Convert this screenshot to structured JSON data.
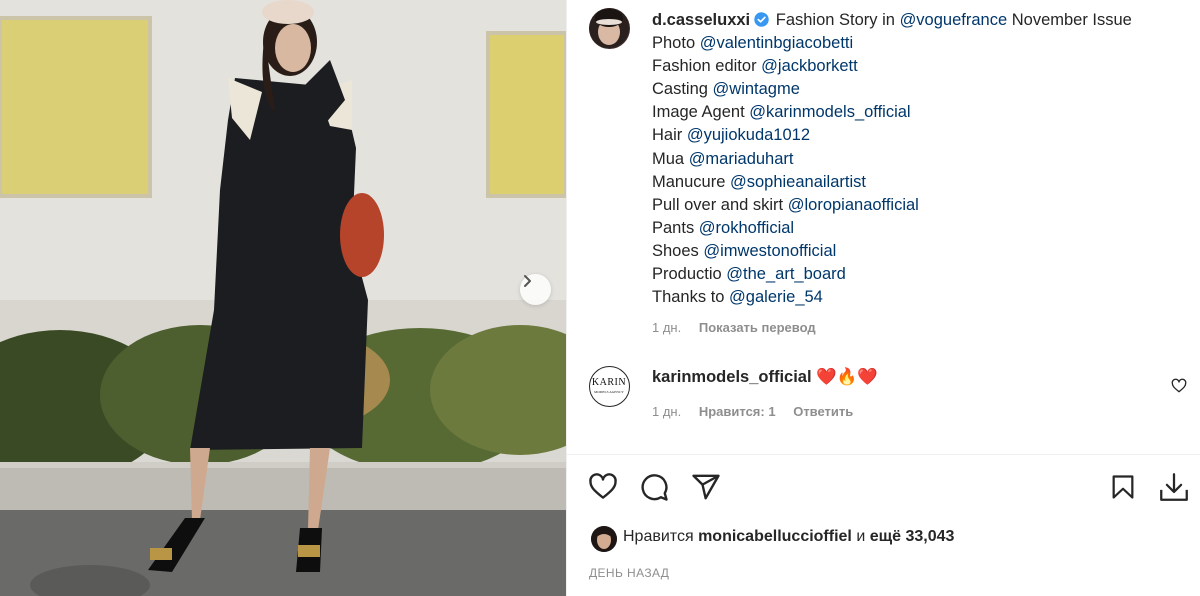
{
  "post": {
    "author": "d.casseluxxi",
    "caption_lines": [
      {
        "text": "Fashion Story in ",
        "mention": "@voguefrance",
        "tail": " November Issue"
      },
      {
        "text": "Photo ",
        "mention": "@valentinbgiacobetti"
      },
      {
        "text": "Fashion editor ",
        "mention": "@jackborkett"
      },
      {
        "text": "Casting ",
        "mention": "@wintagme"
      },
      {
        "text": "Image Agent ",
        "mention": "@karinmodels_official"
      },
      {
        "text": "Hair ",
        "mention": "@yujiokuda1012"
      },
      {
        "text": "Mua ",
        "mention": "@mariaduhart"
      },
      {
        "text": "Manucure ",
        "mention": "@sophieanailartist"
      },
      {
        "text": "Pull over and skirt ",
        "mention": "@loropianaofficial"
      },
      {
        "text": "Pants ",
        "mention": "@rokhofficial"
      },
      {
        "text": "Shoes ",
        "mention": "@imwestonofficial"
      },
      {
        "text": "Productio ",
        "mention": "@the_art_board"
      },
      {
        "text": "Thanks to ",
        "mention": "@galerie_54"
      }
    ],
    "caption_age": "1 дн.",
    "translate_label": "Показать перевод"
  },
  "comment": {
    "author": "karinmodels_official",
    "emoji": "❤️🔥❤️",
    "avatar_text": "KARIN",
    "avatar_subtext": "MODELS AGENCY",
    "age": "1 дн.",
    "likes_label": "Нравится: 1",
    "reply_label": "Ответить"
  },
  "likes": {
    "prefix": "Нравится",
    "user": "monicabelluccioffiel",
    "middle": " и ",
    "count": "ещё 33,043"
  },
  "date_label": "ДЕНЬ НАЗАД",
  "icons": [
    "heart-icon",
    "comment-icon",
    "share-icon",
    "bookmark-icon",
    "download-icon",
    "chevron-right-icon",
    "verified-badge-icon"
  ],
  "colors": {
    "mention": "#00376b",
    "verified": "#3897f0",
    "muted": "#8e8e8e",
    "text": "#262626"
  }
}
